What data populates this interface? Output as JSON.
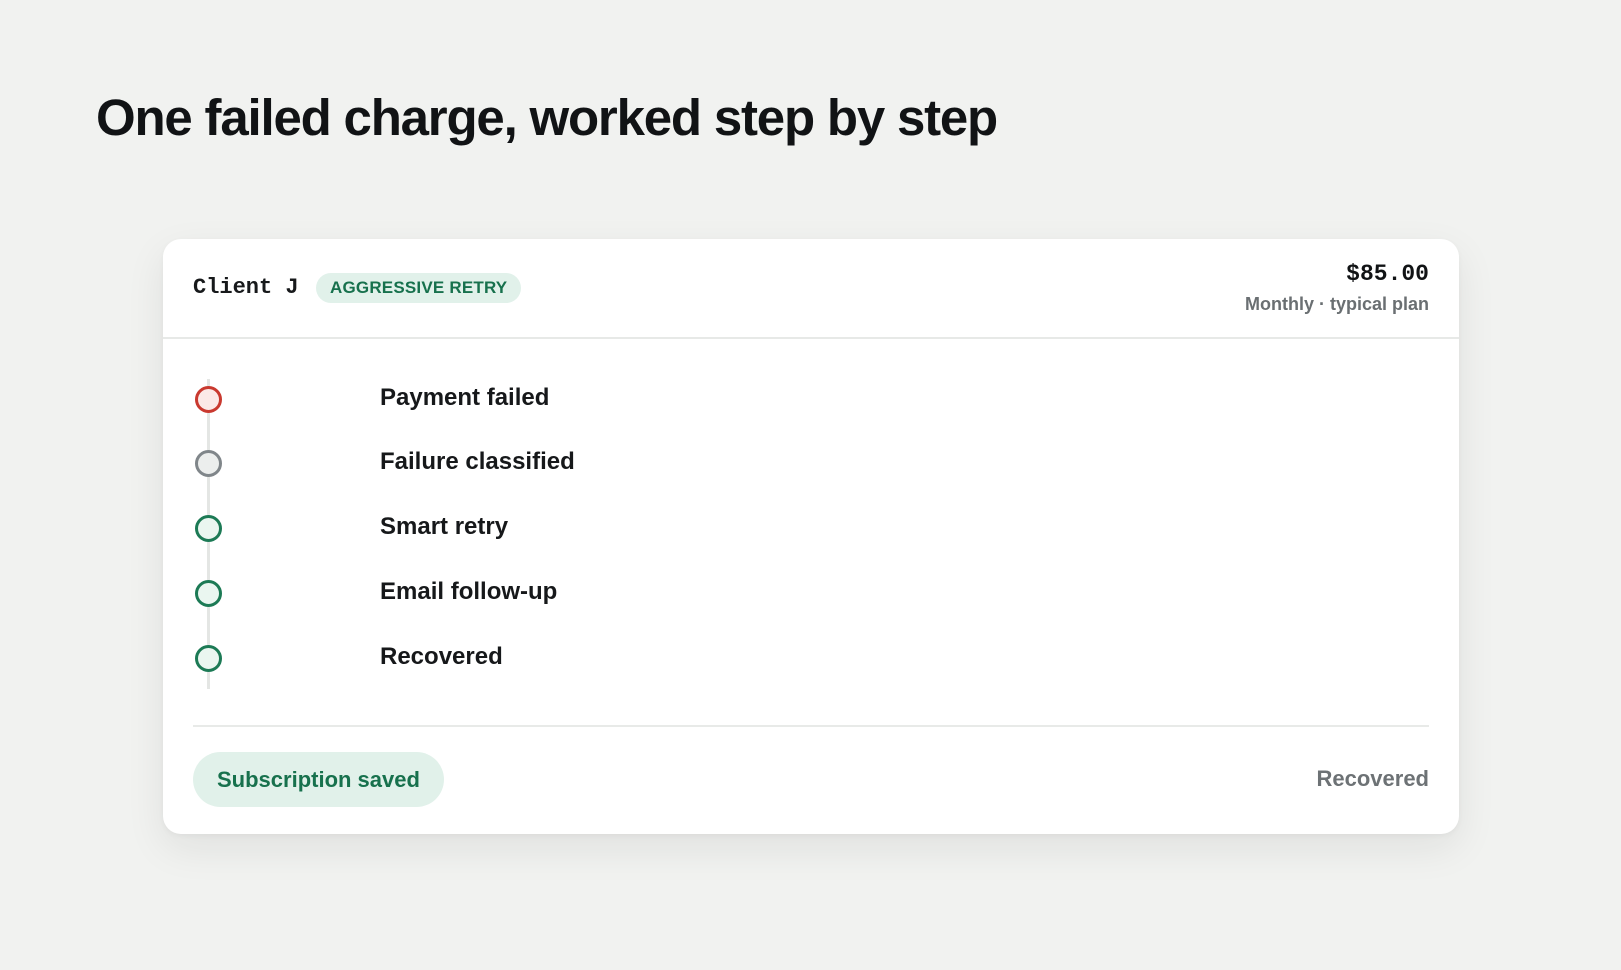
{
  "page": {
    "title": "One failed charge, worked step by step"
  },
  "card": {
    "client_name": "Client J",
    "strategy_badge": "AGGRESSIVE RETRY",
    "amount": "$85.00",
    "plan_note": "Monthly · typical plan",
    "steps": [
      {
        "label": "Payment failed",
        "status": "failed",
        "color": "#c9392f"
      },
      {
        "label": "Failure classified",
        "status": "neutral",
        "color": "#80868a"
      },
      {
        "label": "Smart retry",
        "status": "success",
        "color": "#1c7a55"
      },
      {
        "label": "Email follow-up",
        "status": "success",
        "color": "#1c7a55"
      },
      {
        "label": "Recovered",
        "status": "success",
        "color": "#1c7a55"
      }
    ],
    "result_pill": "Subscription saved",
    "result_status": "Recovered"
  },
  "colors": {
    "background": "#f1f2f0",
    "accent_green": "#17714d",
    "badge_background": "#e1f1ea",
    "failed_red": "#c9392f",
    "neutral_gray": "#80868a"
  }
}
